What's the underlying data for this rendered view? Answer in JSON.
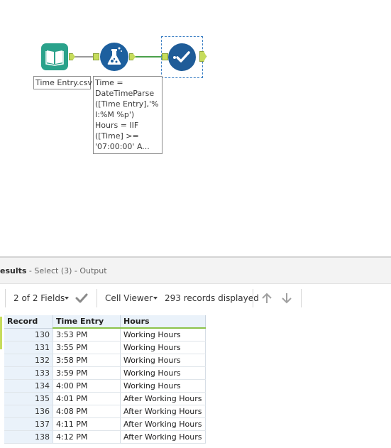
{
  "canvas": {
    "input_tool": {
      "label": "Time Entry.csv",
      "icon": "book-icon",
      "color": "#2aa28b"
    },
    "formula_tool": {
      "icon": "flask-icon",
      "color": "#1d5f9e",
      "annotation_lines": [
        "Time =",
        "DateTimeParse",
        "([Time Entry],'%",
        "I:%M %p')",
        "Hours = IIF",
        "([Time] >=",
        "'07:00:00' A..."
      ]
    },
    "select_tool": {
      "icon": "checkmark-icon",
      "color": "#1f5c98"
    }
  },
  "results": {
    "title_bold": "esults",
    "title_rest": " - Select (3) - Output",
    "toolbar": {
      "fields_label": "2 of 2 Fields",
      "viewer_label": "Cell Viewer",
      "records_label": "293 records displayed"
    },
    "columns": [
      "Record",
      "Time Entry",
      "Hours"
    ],
    "rows": [
      [
        "130",
        "3:53 PM",
        "Working Hours"
      ],
      [
        "131",
        "3:55 PM",
        "Working Hours"
      ],
      [
        "132",
        "3:58 PM",
        "Working Hours"
      ],
      [
        "133",
        "3:59 PM",
        "Working Hours"
      ],
      [
        "134",
        "4:00 PM",
        "Working Hours"
      ],
      [
        "135",
        "4:01 PM",
        "After Working Hours"
      ],
      [
        "136",
        "4:08 PM",
        "After Working Hours"
      ],
      [
        "137",
        "4:11 PM",
        "After Working Hours"
      ],
      [
        "138",
        "4:12 PM",
        "After Working Hours"
      ]
    ]
  }
}
